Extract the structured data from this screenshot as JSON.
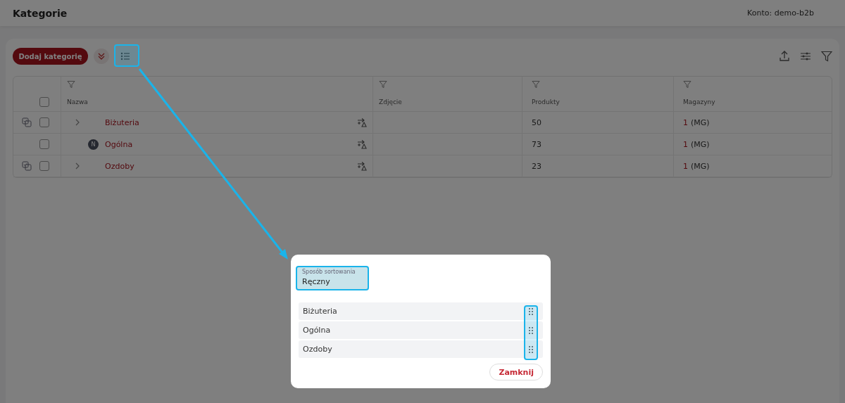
{
  "header": {
    "title": "Kategorie",
    "account": "Konto: demo-b2b"
  },
  "toolbar": {
    "add_button": "Dodaj kategorię"
  },
  "table": {
    "columns": [
      "Nazwa",
      "Zdjęcie",
      "Produkty",
      "Magazyny"
    ],
    "select_all_checked": false,
    "rows": [
      {
        "name": "Biżuteria",
        "has_children": true,
        "checked": false,
        "products": "50",
        "warehouse_count": "1",
        "warehouse_code": "(MG)"
      },
      {
        "name": "Ogólna",
        "has_children": false,
        "checked": false,
        "badge": "N",
        "products": "73",
        "warehouse_count": "1",
        "warehouse_code": "(MG)"
      },
      {
        "name": "Ozdoby",
        "has_children": true,
        "checked": false,
        "products": "23",
        "warehouse_count": "1",
        "warehouse_code": "(MG)"
      }
    ]
  },
  "dialog": {
    "sort_field": {
      "label": "Sposób sortowania",
      "value": "Ręczny"
    },
    "items": [
      "Biżuteria",
      "Ogólna",
      "Ozdoby"
    ],
    "close_button": "Zamknij"
  }
}
